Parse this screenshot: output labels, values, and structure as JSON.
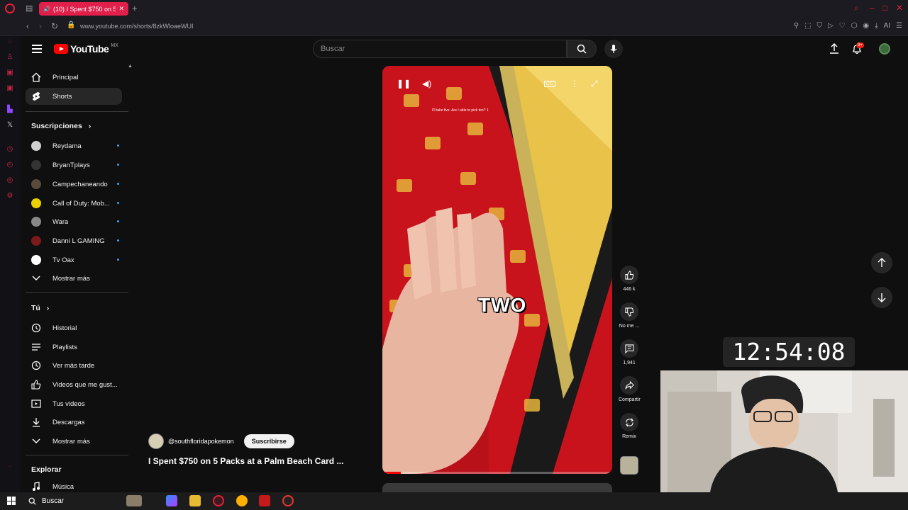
{
  "browser": {
    "tab_title": "(10) I Spent $750 on 5 P",
    "url": "www.youtube.com/shorts/8zkWloaeWUI",
    "ai_label": "AI"
  },
  "header": {
    "logo_text": "YouTube",
    "country_code": "MX",
    "search_placeholder": "Buscar",
    "notification_count": "9+"
  },
  "sidebar": {
    "top": [
      {
        "label": "Principal",
        "icon": "home-icon"
      },
      {
        "label": "Shorts",
        "icon": "shorts-icon",
        "active": true
      }
    ],
    "subscriptions_title": "Suscripciones",
    "subscriptions": [
      {
        "label": "Reydama",
        "color": "#d0d0d0"
      },
      {
        "label": "BryanTplays",
        "color": "#333333"
      },
      {
        "label": "Campechaneando",
        "color": "#5a4a3a"
      },
      {
        "label": "Call of Duty: Mob...",
        "color": "#e8d000"
      },
      {
        "label": "Wara",
        "color": "#888888"
      },
      {
        "label": "Danni L GAMING",
        "color": "#7a1a1a"
      },
      {
        "label": "Tv Oax",
        "color": "#ffffff"
      }
    ],
    "show_more": "Mostrar más",
    "you_title": "Tú",
    "you": [
      {
        "label": "Historial",
        "icon": "history-icon"
      },
      {
        "label": "Playlists",
        "icon": "playlist-icon"
      },
      {
        "label": "Ver más tarde",
        "icon": "clock-icon"
      },
      {
        "label": "Videos que me gust...",
        "icon": "like-icon"
      },
      {
        "label": "Tus videos",
        "icon": "video-icon"
      },
      {
        "label": "Descargas",
        "icon": "download-icon"
      },
      {
        "label": "Mostrar más",
        "icon": "chevron-down-icon"
      }
    ],
    "explore_title": "Explorar",
    "explore": [
      {
        "label": "Música",
        "icon": "music-icon"
      }
    ]
  },
  "short": {
    "overlay_word": "TWO",
    "tiny_caption": "I'll take five. Are I able to pick ten? 1",
    "channel": "@southfloridapokemon",
    "subscribe_label": "Suscribirse",
    "title": "I Spent $750 on 5 Packs at a Palm Beach Card ...",
    "progress": 0.08,
    "cc_label": "CC"
  },
  "actions": {
    "likes": "446 k",
    "dislike": "No me ...",
    "comments": "1,941",
    "share": "Compartir",
    "remix": "Remix"
  },
  "overlay": {
    "clock": "12:54:08"
  },
  "taskbar": {
    "search_label": "Buscar"
  }
}
